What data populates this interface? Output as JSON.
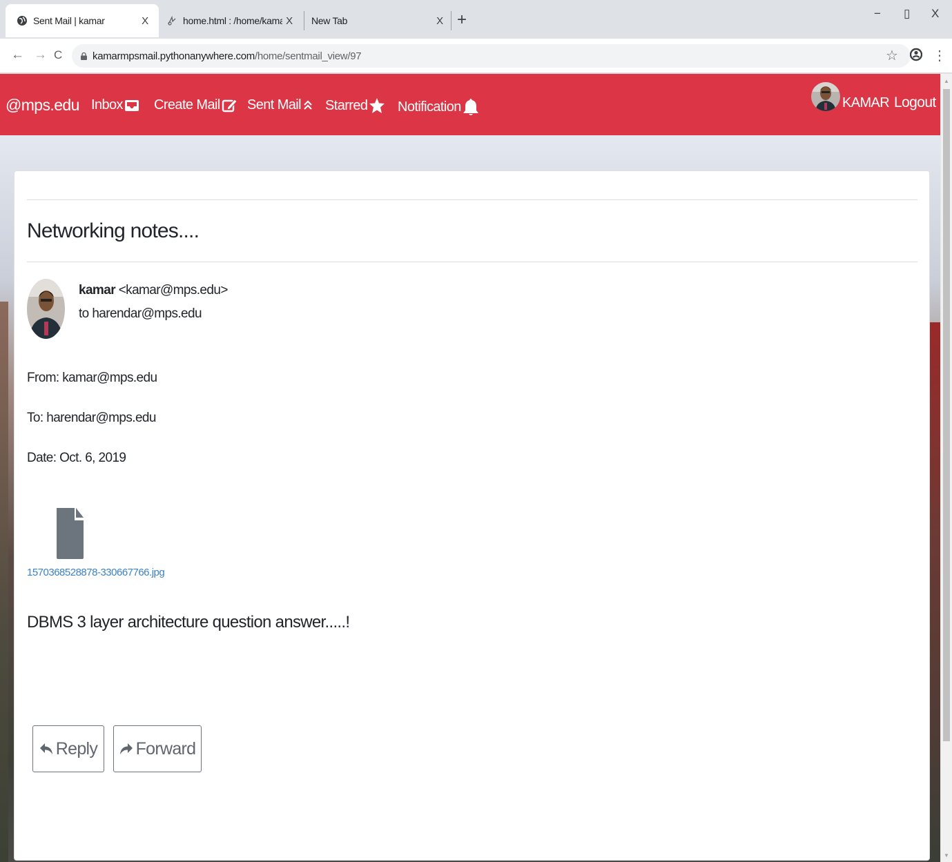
{
  "browser": {
    "tabs": [
      {
        "title": "Sent Mail | kamar",
        "close": "X",
        "icon": "globe-icon"
      },
      {
        "title": "home.html : /home/kamarmpsmail",
        "close": "X",
        "icon": "pythonanywhere-icon"
      },
      {
        "title": "New Tab",
        "close": "X"
      }
    ],
    "new_tab": "+",
    "window_controls": {
      "minimize": "−",
      "maximize": "▯",
      "close": "X"
    },
    "nav": {
      "back": "←",
      "forward": "→",
      "reload": "C"
    },
    "url_host": "kamarmpsmail.pythonanywhere.com",
    "url_path": "/home/sentmail_view/97",
    "bookmark": "☆",
    "menu": "⋮"
  },
  "navbar": {
    "brand": "@mps.edu",
    "items": [
      {
        "label": "Inbox",
        "icon": "inbox-icon"
      },
      {
        "label": "Create Mail",
        "icon": "edit-icon"
      },
      {
        "label": "Sent Mail",
        "icon": "double-chevron-up-icon"
      },
      {
        "label": "Starred",
        "icon": "star-icon"
      },
      {
        "label": "Notification",
        "icon": "bell-icon"
      }
    ],
    "user": "KAMAR",
    "logout": "Logout",
    "color": "#dc3545"
  },
  "mail": {
    "subject": "Networking notes....",
    "sender_name": "kamar",
    "sender_email": "<kamar@mps.edu>",
    "recipient_line": "to harendar@mps.edu",
    "from": "From: kamar@mps.edu",
    "to": "To: harendar@mps.edu",
    "date": "Date: Oct. 6, 2019",
    "attachment": "1570368528878-330667766.jpg",
    "body": "DBMS 3 layer architecture question answer.....!"
  },
  "actions": {
    "reply": "Reply",
    "forward": "Forward"
  }
}
